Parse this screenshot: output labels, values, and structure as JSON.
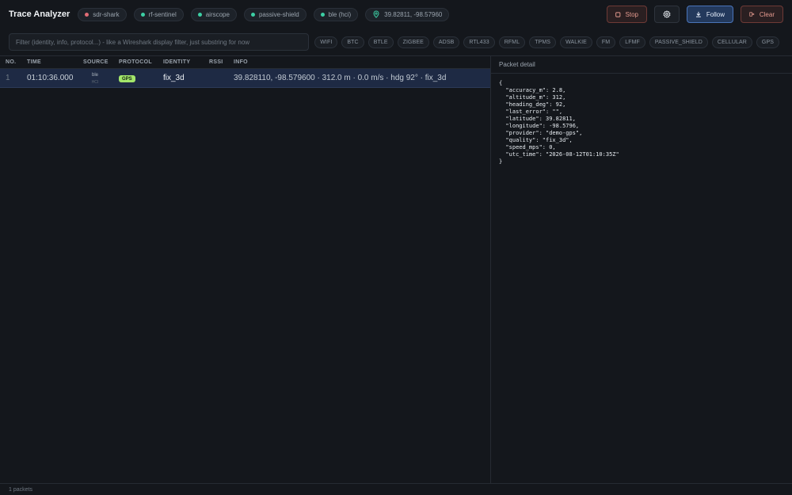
{
  "app": {
    "title": "Trace Analyzer"
  },
  "sources": [
    {
      "label": "sdr-shark",
      "status_color": "#e06c75"
    },
    {
      "label": "rf-sentinel",
      "status_color": "#3ccfa4"
    },
    {
      "label": "airscope",
      "status_color": "#3ccfa4"
    },
    {
      "label": "passive-shield",
      "status_color": "#3ccfa4"
    },
    {
      "label": "ble (hci)",
      "status_color": "#3ccfa4"
    }
  ],
  "location": {
    "icon": "map-pin-icon",
    "text": "39.82811, -98.57960",
    "color": "#3ccfa4"
  },
  "actions": {
    "stop_label": "Stop",
    "follow_label": "Follow",
    "clear_label": "Clear"
  },
  "filter": {
    "placeholder": "Filter (identity, info, protocol...) - like a Wireshark display filter, just substring for now",
    "value": ""
  },
  "protocols": [
    "WIFI",
    "BTC",
    "BTLE",
    "ZIGBEE",
    "ADSB",
    "RTL433",
    "RFML",
    "TPMS",
    "WALKIE",
    "FM",
    "LFMF",
    "PASSIVE_SHIELD",
    "CELLULAR",
    "GPS"
  ],
  "table": {
    "columns": {
      "no": "NO.",
      "time": "TIME",
      "source": "SOURCE",
      "protocol": "PROTOCOL",
      "identity": "IDENTITY",
      "rssi": "RSSI",
      "info": "INFO"
    },
    "rows": [
      {
        "no": "1",
        "time": "01:10:36.000",
        "source": "ble",
        "source_sub": "HCI",
        "protocol": "GPS",
        "identity": "fix_3d",
        "rssi": "",
        "info": "39.828110, -98.579600 · 312.0 m · 0.0 m/s · hdg 92° · fix_3d"
      }
    ]
  },
  "detail": {
    "title": "Packet detail",
    "json": "{\n  \"accuracy_m\": 2.8,\n  \"altitude_m\": 312,\n  \"heading_deg\": 92,\n  \"last_error\": \"\",\n  \"latitude\": 39.82811,\n  \"longitude\": -98.5796,\n  \"provider\": \"demo-gps\",\n  \"quality\": \"fix_3d\",\n  \"speed_mps\": 0,\n  \"utc_time\": \"2026-08-12T01:10:35Z\"\n}"
  },
  "status": {
    "packet_count": "1 packets"
  }
}
